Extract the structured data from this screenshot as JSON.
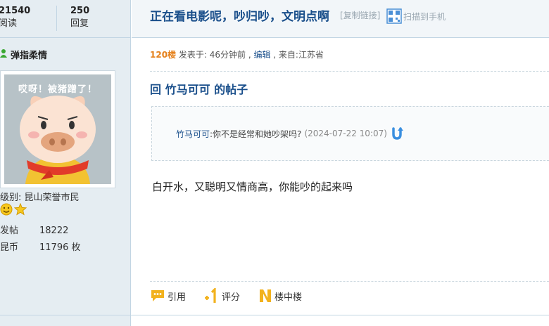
{
  "stats": {
    "views_num": "21540",
    "views_label": "阅读",
    "replies_num": "250",
    "replies_label": "回复"
  },
  "thread": {
    "title": "正在看电影呢，吵归吵，文明点啊",
    "copy_link": "[复制链接]",
    "qr_label": "扫描到手机"
  },
  "author": {
    "name": "弹指柔情",
    "avatar_caption": "哎呀！被猪蹭了！",
    "level": "级别: 昆山荣誉市民",
    "posts_label": "发帖",
    "posts_value": "18222",
    "coins_label": "昆币",
    "coins_value": "11796 枚"
  },
  "post": {
    "floor": "120楼",
    "meta_pre": " 发表于: 46分钟前 , ",
    "edit": "编辑",
    "meta_post": " , 来自:江苏省",
    "reply_title": "回 竹马可可 的帖子",
    "quote_author": "竹马可可",
    "quote_text": ":你不是经常和她吵架吗?",
    "quote_time": "(2024-07-22 10:07)",
    "body": "白开水，又聪明又情商高，你能吵的起来吗"
  },
  "actions": {
    "quote": "引用",
    "rate": "评分",
    "inner": "楼中楼"
  },
  "colors": {
    "link_blue": "#1a4f8b",
    "floor_orange": "#e5801a",
    "sidebar_bg": "#e5edf2"
  }
}
